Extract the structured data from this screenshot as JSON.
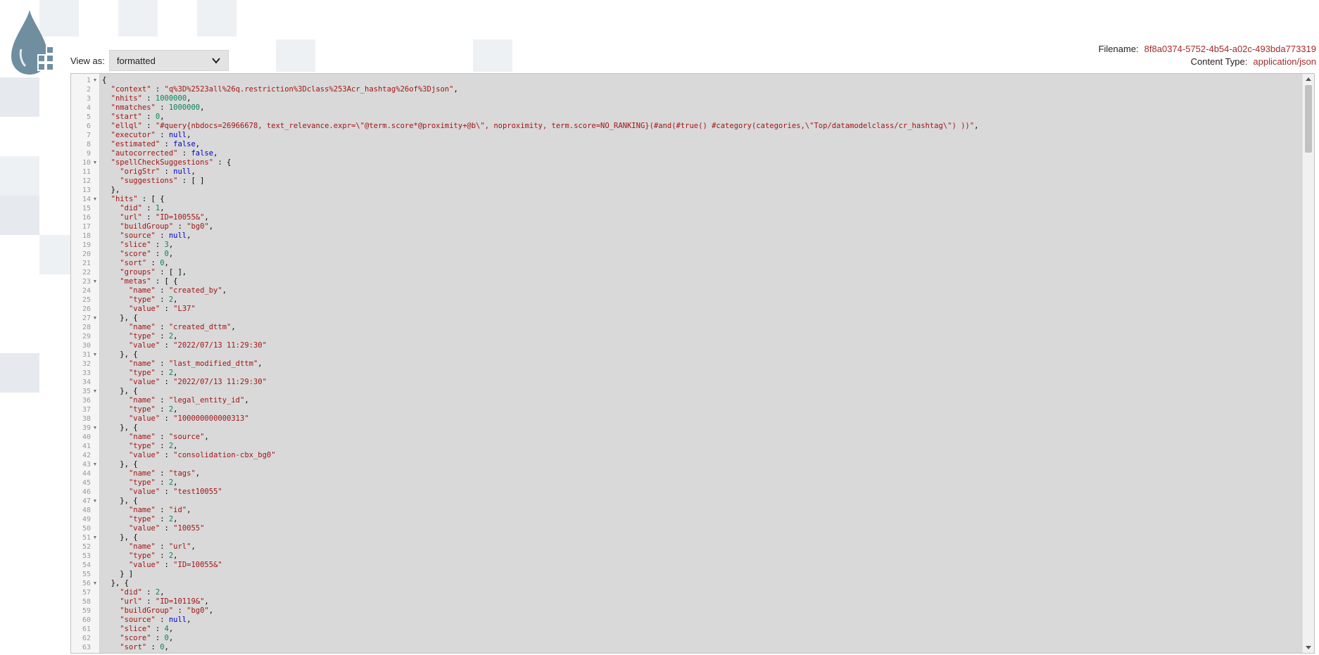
{
  "view_as": {
    "label": "View as:",
    "selected": "formatted"
  },
  "file": {
    "filename_label": "Filename:",
    "filename_value": "8f8a0374-5752-4b54-a02c-493bda773319",
    "content_type_label": "Content Type:",
    "content_type_value": "application/json"
  },
  "icons": {
    "logo": "water-drop-grid-logo",
    "select_arrow": "chevron-down-icon",
    "fold": "fold-triangle-icon"
  },
  "colors": {
    "editor_bg": "#d9d9d9",
    "string": "#a31515",
    "number": "#098658",
    "keyword": "#0000cd"
  },
  "editor": {
    "lines": [
      {
        "n": "1",
        "fold": true,
        "code": "{"
      },
      {
        "n": "2",
        "fold": false,
        "code": "  \"context\" : \"q%3D%2523all%26q.restriction%3Dclass%253Acr_hashtag%26of%3Djson\","
      },
      {
        "n": "3",
        "fold": false,
        "code": "  \"nhits\" : 1000000,"
      },
      {
        "n": "4",
        "fold": false,
        "code": "  \"nmatches\" : 1000000,"
      },
      {
        "n": "5",
        "fold": false,
        "code": "  \"start\" : 0,"
      },
      {
        "n": "6",
        "fold": false,
        "code": "  \"ellql\" : \"#query{nbdocs=26966678, text_relevance.expr=\\\"@term.score*@proximity+@b\\\", noproximity, term.score=NO_RANKING}(#and(#true() #category(categories,\\\"Top/datamodelclass/cr_hashtag\\\") ))\","
      },
      {
        "n": "7",
        "fold": false,
        "code": "  \"executor\" : null,"
      },
      {
        "n": "8",
        "fold": false,
        "code": "  \"estimated\" : false,"
      },
      {
        "n": "9",
        "fold": false,
        "code": "  \"autocorrected\" : false,"
      },
      {
        "n": "10",
        "fold": true,
        "code": "  \"spellCheckSuggestions\" : {"
      },
      {
        "n": "11",
        "fold": false,
        "code": "    \"origStr\" : null,"
      },
      {
        "n": "12",
        "fold": false,
        "code": "    \"suggestions\" : [ ]"
      },
      {
        "n": "13",
        "fold": false,
        "code": "  },"
      },
      {
        "n": "14",
        "fold": true,
        "code": "  \"hits\" : [ {"
      },
      {
        "n": "15",
        "fold": false,
        "code": "    \"did\" : 1,"
      },
      {
        "n": "16",
        "fold": false,
        "code": "    \"url\" : \"ID=10055&\","
      },
      {
        "n": "17",
        "fold": false,
        "code": "    \"buildGroup\" : \"bg0\","
      },
      {
        "n": "18",
        "fold": false,
        "code": "    \"source\" : null,"
      },
      {
        "n": "19",
        "fold": false,
        "code": "    \"slice\" : 3,"
      },
      {
        "n": "20",
        "fold": false,
        "code": "    \"score\" : 0,"
      },
      {
        "n": "21",
        "fold": false,
        "code": "    \"sort\" : 0,"
      },
      {
        "n": "22",
        "fold": false,
        "code": "    \"groups\" : [ ],"
      },
      {
        "n": "23",
        "fold": true,
        "code": "    \"metas\" : [ {"
      },
      {
        "n": "24",
        "fold": false,
        "code": "      \"name\" : \"created_by\","
      },
      {
        "n": "25",
        "fold": false,
        "code": "      \"type\" : 2,"
      },
      {
        "n": "26",
        "fold": false,
        "code": "      \"value\" : \"L37\""
      },
      {
        "n": "27",
        "fold": true,
        "code": "    }, {"
      },
      {
        "n": "28",
        "fold": false,
        "code": "      \"name\" : \"created_dttm\","
      },
      {
        "n": "29",
        "fold": false,
        "code": "      \"type\" : 2,"
      },
      {
        "n": "30",
        "fold": false,
        "code": "      \"value\" : \"2022/07/13 11:29:30\""
      },
      {
        "n": "31",
        "fold": true,
        "code": "    }, {"
      },
      {
        "n": "32",
        "fold": false,
        "code": "      \"name\" : \"last_modified_dttm\","
      },
      {
        "n": "33",
        "fold": false,
        "code": "      \"type\" : 2,"
      },
      {
        "n": "34",
        "fold": false,
        "code": "      \"value\" : \"2022/07/13 11:29:30\""
      },
      {
        "n": "35",
        "fold": true,
        "code": "    }, {"
      },
      {
        "n": "36",
        "fold": false,
        "code": "      \"name\" : \"legal_entity_id\","
      },
      {
        "n": "37",
        "fold": false,
        "code": "      \"type\" : 2,"
      },
      {
        "n": "38",
        "fold": false,
        "code": "      \"value\" : \"100000000000313\""
      },
      {
        "n": "39",
        "fold": true,
        "code": "    }, {"
      },
      {
        "n": "40",
        "fold": false,
        "code": "      \"name\" : \"source\","
      },
      {
        "n": "41",
        "fold": false,
        "code": "      \"type\" : 2,"
      },
      {
        "n": "42",
        "fold": false,
        "code": "      \"value\" : \"consolidation-cbx_bg0\""
      },
      {
        "n": "43",
        "fold": true,
        "code": "    }, {"
      },
      {
        "n": "44",
        "fold": false,
        "code": "      \"name\" : \"tags\","
      },
      {
        "n": "45",
        "fold": false,
        "code": "      \"type\" : 2,"
      },
      {
        "n": "46",
        "fold": false,
        "code": "      \"value\" : \"test10055\""
      },
      {
        "n": "47",
        "fold": true,
        "code": "    }, {"
      },
      {
        "n": "48",
        "fold": false,
        "code": "      \"name\" : \"id\","
      },
      {
        "n": "49",
        "fold": false,
        "code": "      \"type\" : 2,"
      },
      {
        "n": "50",
        "fold": false,
        "code": "      \"value\" : \"10055\""
      },
      {
        "n": "51",
        "fold": true,
        "code": "    }, {"
      },
      {
        "n": "52",
        "fold": false,
        "code": "      \"name\" : \"url\","
      },
      {
        "n": "53",
        "fold": false,
        "code": "      \"type\" : 2,"
      },
      {
        "n": "54",
        "fold": false,
        "code": "      \"value\" : \"ID=10055&\""
      },
      {
        "n": "55",
        "fold": false,
        "code": "    } ]"
      },
      {
        "n": "56",
        "fold": true,
        "code": "  }, {"
      },
      {
        "n": "57",
        "fold": false,
        "code": "    \"did\" : 2,"
      },
      {
        "n": "58",
        "fold": false,
        "code": "    \"url\" : \"ID=10119&\","
      },
      {
        "n": "59",
        "fold": false,
        "code": "    \"buildGroup\" : \"bg0\","
      },
      {
        "n": "60",
        "fold": false,
        "code": "    \"source\" : null,"
      },
      {
        "n": "61",
        "fold": false,
        "code": "    \"slice\" : 4,"
      },
      {
        "n": "62",
        "fold": false,
        "code": "    \"score\" : 0,"
      },
      {
        "n": "63",
        "fold": false,
        "code": "    \"sort\" : 0,"
      }
    ]
  }
}
